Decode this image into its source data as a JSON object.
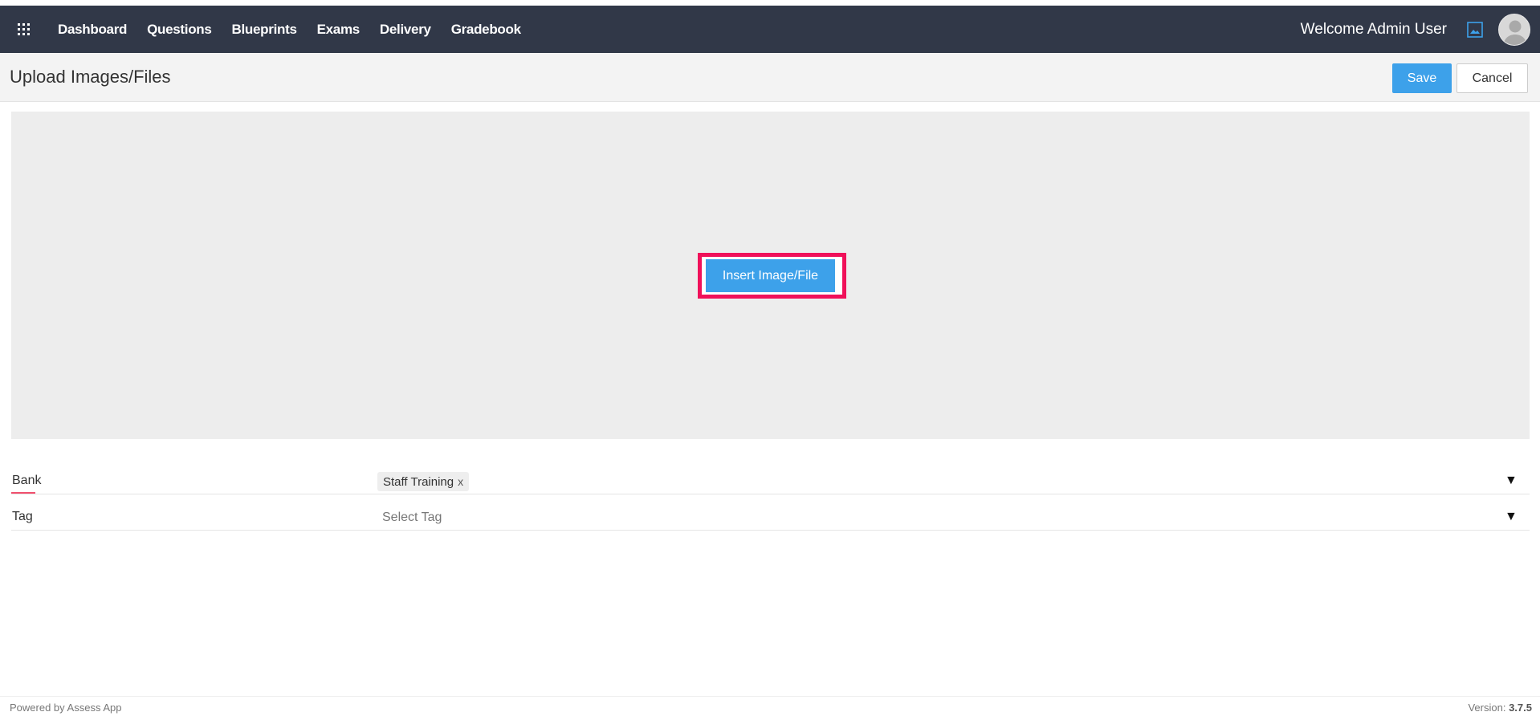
{
  "nav": {
    "items": [
      "Dashboard",
      "Questions",
      "Blueprints",
      "Exams",
      "Delivery",
      "Gradebook"
    ],
    "welcome": "Welcome Admin User",
    "icons": {
      "apps": "apps-grid-icon",
      "image": "image-icon",
      "avatar": "user-avatar-icon"
    },
    "colors": {
      "bar": "#313848",
      "accent": "#3da1ea"
    }
  },
  "page": {
    "title": "Upload Images/Files",
    "save_label": "Save",
    "cancel_label": "Cancel"
  },
  "dropzone": {
    "insert_label": "Insert Image/File",
    "highlight_color": "#f0115a"
  },
  "form": {
    "bank": {
      "label": "Bank",
      "selected": "Staff Training",
      "remove": "x",
      "arrow": "▼"
    },
    "tag": {
      "label": "Tag",
      "placeholder": "Select Tag",
      "arrow": "▼"
    }
  },
  "footer": {
    "powered_by": "Powered by Assess App",
    "version_label": "Version:",
    "version_value": "3.7.5"
  }
}
